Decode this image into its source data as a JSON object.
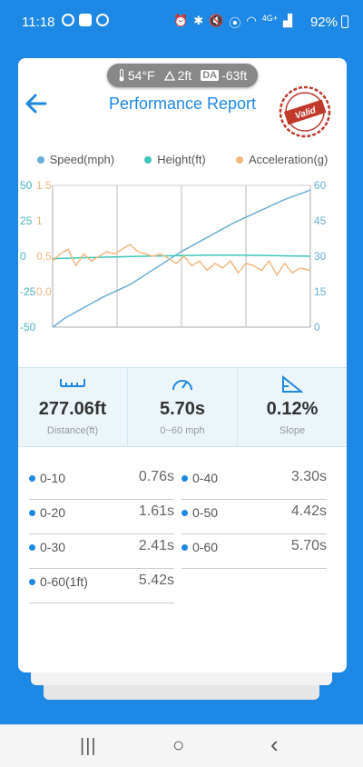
{
  "status_bar": {
    "time": "11:18",
    "battery": "92%",
    "network": "4G+"
  },
  "card": {
    "title": "Performance Report",
    "stamp_text": "Valid",
    "conditions": {
      "temperature": "54°F",
      "elevation": "2ft",
      "da_label": "DA",
      "density_altitude": "-63ft"
    },
    "legend": [
      {
        "label": "Speed(mph)",
        "color": "#6baed6"
      },
      {
        "label": "Height(ft)",
        "color": "#3cc5b8"
      },
      {
        "label": "Acceleration(g)",
        "color": "#f2b880"
      }
    ]
  },
  "chart_data": {
    "type": "line",
    "left_axis_speed": {
      "ticks": [
        "50",
        "25",
        "0",
        "-25",
        "-50"
      ],
      "color": "#6baed6"
    },
    "left_axis_accel": {
      "ticks": [
        "1.5",
        "1",
        "0.5",
        "0.0"
      ],
      "color": "#f2b880"
    },
    "left_axis_height": {
      "ticks": [
        "50",
        "25",
        "0",
        "-25",
        "-50"
      ],
      "color": "#3cc5b8"
    },
    "right_axis": {
      "ticks": [
        "60",
        "45",
        "30",
        "15",
        "0"
      ],
      "range": [
        0,
        60
      ]
    },
    "series": [
      {
        "name": "Speed(mph)",
        "color": "#6baed6",
        "x": [
          0,
          0.05,
          0.1,
          0.2,
          0.3,
          0.4,
          0.5,
          0.6,
          0.7,
          0.8,
          0.9,
          1.0
        ],
        "values": [
          0,
          4,
          7,
          13,
          18,
          25,
          32,
          38,
          44,
          49,
          54,
          58
        ]
      },
      {
        "name": "Height(ft)",
        "color": "#3cc5b8",
        "x": [
          0,
          0.1,
          0.2,
          0.3,
          0.4,
          0.5,
          0.6,
          0.7,
          0.8,
          0.9,
          1.0
        ],
        "values": [
          29,
          29.3,
          29.6,
          29.9,
          30.1,
          30.3,
          30.5,
          30.5,
          30.4,
          30.2,
          30.0
        ]
      },
      {
        "name": "Acceleration(g)",
        "color": "#f2b880",
        "x": [
          0,
          0.03,
          0.06,
          0.09,
          0.12,
          0.15,
          0.18,
          0.21,
          0.24,
          0.27,
          0.3,
          0.33,
          0.36,
          0.39,
          0.42,
          0.45,
          0.48,
          0.51,
          0.54,
          0.57,
          0.6,
          0.63,
          0.66,
          0.69,
          0.72,
          0.75,
          0.78,
          0.81,
          0.84,
          0.87,
          0.9,
          0.93,
          0.96,
          1.0
        ],
        "values": [
          28,
          31,
          33,
          26,
          31,
          28,
          30,
          32,
          31,
          33,
          35,
          32,
          31,
          30,
          31,
          29,
          27,
          30,
          26,
          28,
          24,
          27,
          25,
          28,
          23,
          27,
          26,
          24,
          28,
          22,
          27,
          23,
          25,
          24
        ]
      }
    ]
  },
  "metrics": [
    {
      "icon": "ruler-icon",
      "value": "277.06ft",
      "label": "Distance(ft)"
    },
    {
      "icon": "speedometer-icon",
      "value": "5.70s",
      "label": "0~60 mph"
    },
    {
      "icon": "slope-icon",
      "value": "0.12%",
      "label": "Slope"
    }
  ],
  "splits": [
    {
      "label": "0-10",
      "value": "0.76s"
    },
    {
      "label": "0-40",
      "value": "3.30s"
    },
    {
      "label": "0-20",
      "value": "1.61s"
    },
    {
      "label": "0-50",
      "value": "4.42s"
    },
    {
      "label": "0-30",
      "value": "2.41s"
    },
    {
      "label": "0-60",
      "value": "5.70s"
    },
    {
      "label": "0-60(1ft)",
      "value": "5.42s"
    }
  ],
  "nav": {
    "recents": "|||",
    "home": "○",
    "back": "‹"
  }
}
